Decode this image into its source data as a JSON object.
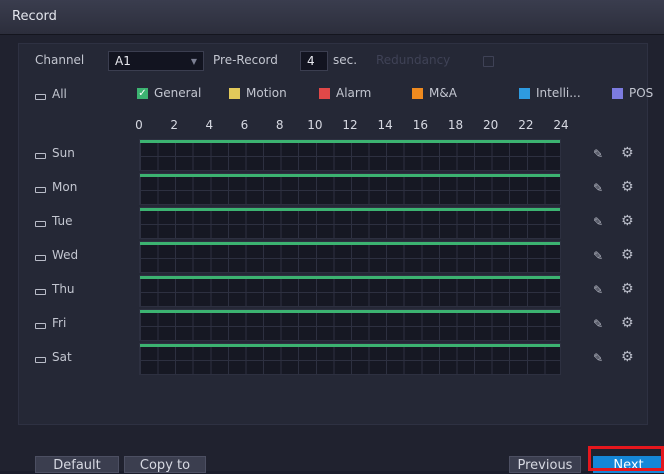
{
  "title": "Record",
  "channel": {
    "label": "Channel",
    "value": "A1"
  },
  "prerecord": {
    "label": "Pre-Record",
    "value": "4",
    "unit": "sec."
  },
  "redundancy": {
    "label": "Redundancy"
  },
  "all_label": "All",
  "legend": [
    {
      "label": "General",
      "color": "#3cb371",
      "checked": true
    },
    {
      "label": "Motion",
      "color": "#e2c95a",
      "checked": false
    },
    {
      "label": "Alarm",
      "color": "#e04848",
      "checked": false
    },
    {
      "label": "M&A",
      "color": "#ef8a1f",
      "checked": false
    },
    {
      "label": "Intelli...",
      "color": "#2e9be0",
      "checked": false
    },
    {
      "label": "POS",
      "color": "#7c7be0",
      "checked": false
    }
  ],
  "timeline_ticks": [
    "0",
    "2",
    "4",
    "6",
    "8",
    "10",
    "12",
    "14",
    "16",
    "18",
    "20",
    "22",
    "24"
  ],
  "days": [
    {
      "label": "Sun",
      "general_coverage": 1.0
    },
    {
      "label": "Mon",
      "general_coverage": 1.0
    },
    {
      "label": "Tue",
      "general_coverage": 1.0
    },
    {
      "label": "Wed",
      "general_coverage": 1.0
    },
    {
      "label": "Thu",
      "general_coverage": 1.0
    },
    {
      "label": "Fri",
      "general_coverage": 1.0
    },
    {
      "label": "Sat",
      "general_coverage": 1.0
    }
  ],
  "buttons": {
    "default": "Default",
    "copy_to": "Copy to",
    "previous": "Previous",
    "next": "Next"
  },
  "icons": {
    "edit": "pencil-icon",
    "settings": "gear-icon"
  }
}
